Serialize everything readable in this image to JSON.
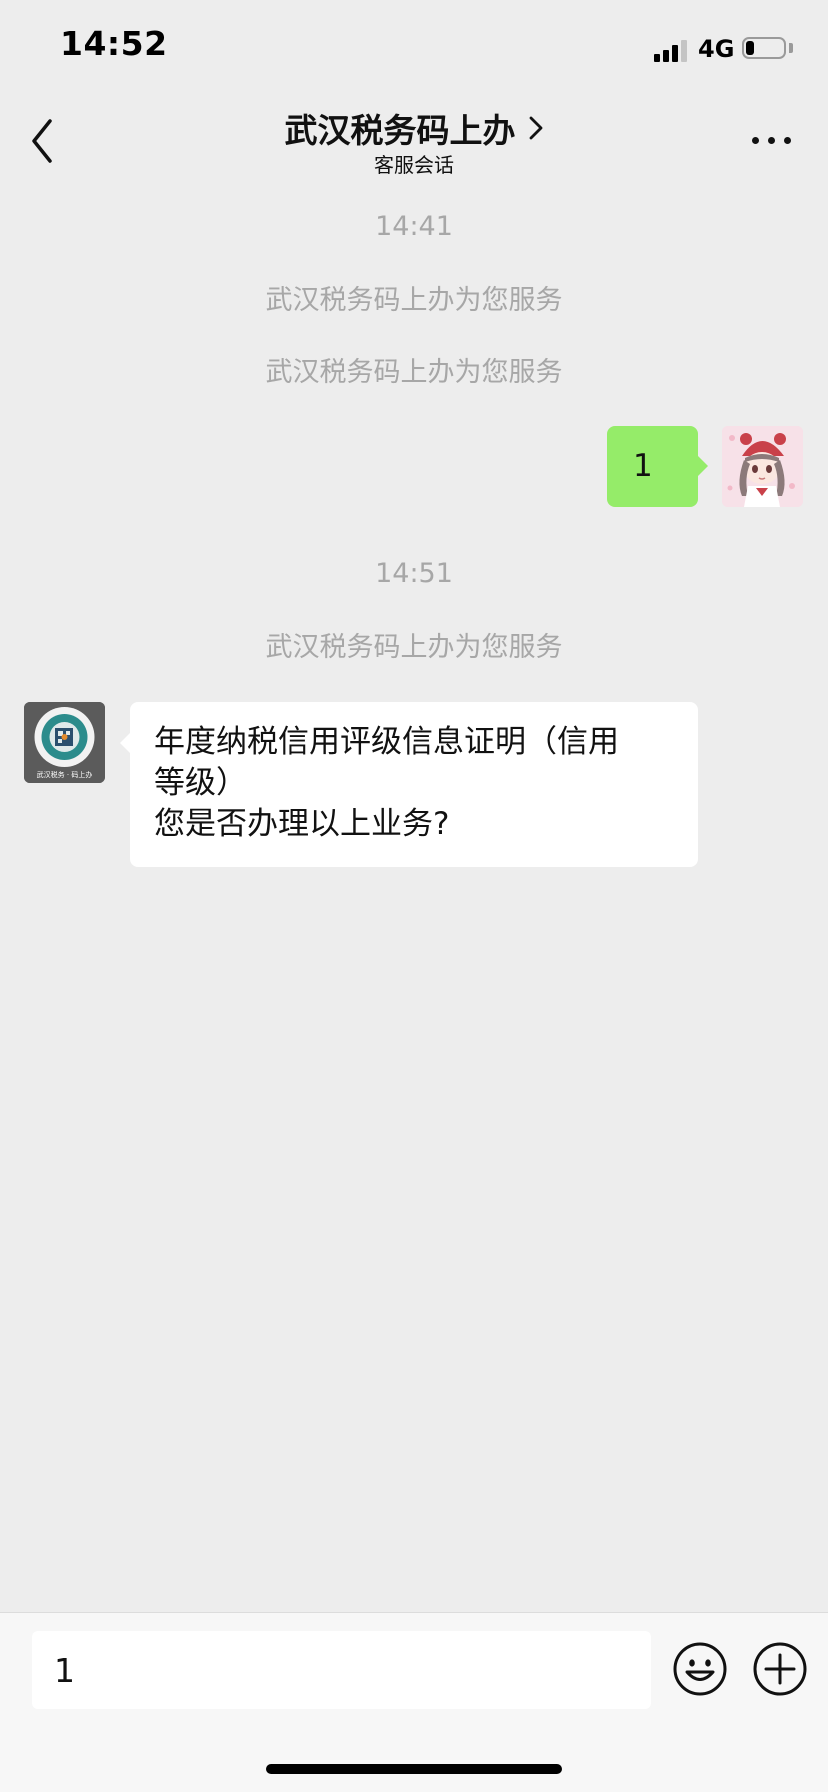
{
  "status_bar": {
    "time": "14:52",
    "network": "4G",
    "battery_level": 0.22,
    "signal_bars": 3
  },
  "nav": {
    "title": "武汉税务码上办",
    "subtitle": "客服会话",
    "back_icon": "chevron-left-icon",
    "title_chevron_icon": "chevron-right-icon",
    "more_icon": "more-icon"
  },
  "messages": [
    {
      "type": "timestamp",
      "text": "14:41"
    },
    {
      "type": "system",
      "text": "武汉税务码上办为您服务"
    },
    {
      "type": "system",
      "text": "武汉税务码上办为您服务"
    },
    {
      "type": "outgoing",
      "text": "1"
    },
    {
      "type": "timestamp",
      "text": "14:51"
    },
    {
      "type": "system",
      "text": "武汉税务码上办为您服务"
    },
    {
      "type": "incoming",
      "lines": [
        "年度纳税信用评级信息证明（信用",
        "等级）",
        "您是否办理以上业务?"
      ]
    }
  ],
  "bot_avatar": {
    "caption": "武汉税务 · 码上办"
  },
  "input_bar": {
    "value": "1",
    "emoji_icon": "emoji-icon",
    "plus_icon": "plus-circle-icon"
  },
  "colors": {
    "background": "#ededed",
    "outgoing_bubble": "#95ec69",
    "incoming_bubble": "#ffffff",
    "system_text": "#a7a7a7"
  }
}
